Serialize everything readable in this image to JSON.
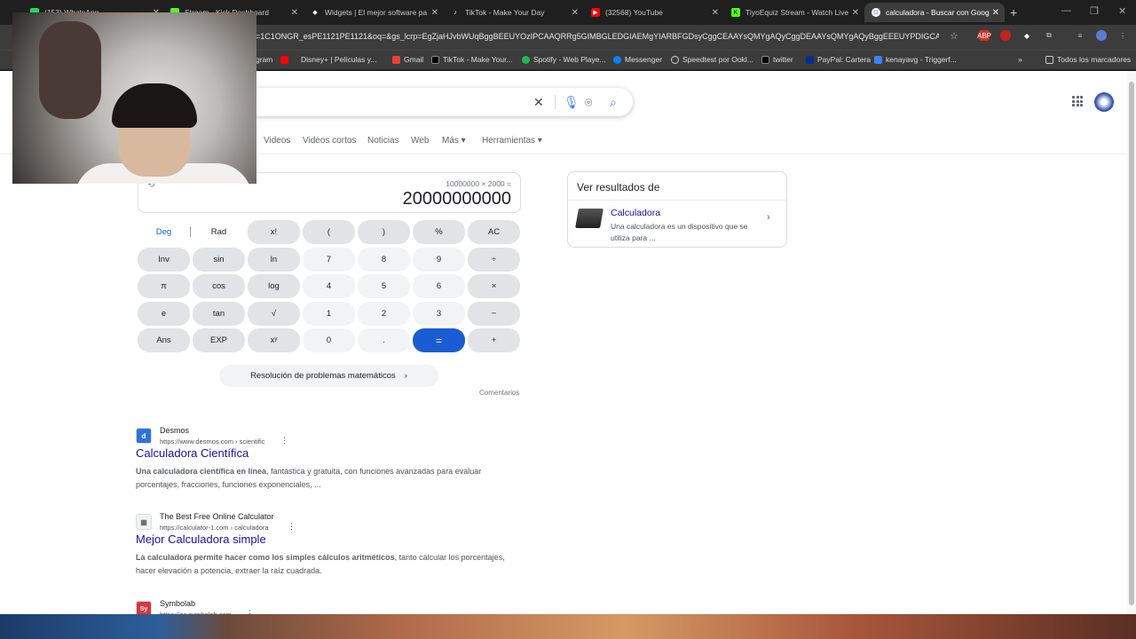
{
  "tabs": [
    {
      "label": "(153) WhatsApp",
      "color": "#25d366"
    },
    {
      "label": "Stream - Kick Dashboard",
      "color": "#53fc18"
    },
    {
      "label": "Widgets | El mejor software pa",
      "color": "#ffffff"
    },
    {
      "label": "TikTok - Make Your Day",
      "color": "#000000"
    },
    {
      "label": "(32568) YouTube",
      "color": "#ff0000"
    },
    {
      "label": "TiyoEquiz Stream - Watch Live",
      "color": "#53fc18"
    },
    {
      "label": "calculadora - Buscar con Goog",
      "color": "#4285f4"
    }
  ],
  "new_tab": "+",
  "url": "=1C1ONGR_esPE1121PE1121&oq=&gs_lcrp=EgZjaHJvbWUqBggBEEUYOzIPCAAQRRg5GIMBGLEDGIAEMgYIARBFGDsyCggCEAAYsQMYgAQyCggDEAAYsQMYgAQyBggEEEUYPDIGCAUQR...",
  "bookmarks": [
    {
      "label": "gram"
    },
    {
      "label": "Disney+ | Películas y..."
    },
    {
      "label": "Gmail"
    },
    {
      "label": "TikTok - Make Your..."
    },
    {
      "label": "Spotify - Web Playe..."
    },
    {
      "label": "Messenger"
    },
    {
      "label": "Speedtest por Ookl..."
    },
    {
      "label": "twitter"
    },
    {
      "label": "PayPal: Cartera"
    },
    {
      "label": "kenayavg - Triggerf..."
    }
  ],
  "all_bookmarks": "Todos los marcadores",
  "filters": [
    "Videos",
    "Videos cortos",
    "Noticias",
    "Web",
    "Más",
    "Herramientas"
  ],
  "calculator": {
    "expression": "10000000 × 2000 =",
    "result": "20000000000",
    "keys": [
      [
        "Deg",
        "Rad",
        "x!",
        "(",
        ")",
        "%",
        "AC"
      ],
      [
        "Inv",
        "sin",
        "ln",
        "7",
        "8",
        "9",
        "÷"
      ],
      [
        "π",
        "cos",
        "log",
        "4",
        "5",
        "6",
        "×"
      ],
      [
        "e",
        "tan",
        "√",
        "1",
        "2",
        "3",
        "−"
      ],
      [
        "Ans",
        "EXP",
        "xʸ",
        "0",
        ".",
        "=",
        "+"
      ]
    ],
    "math_solver": "Resolución de problemas matemáticos",
    "feedback": "Comentarios"
  },
  "side_panel": {
    "title": "Ver resultados de",
    "name": "Calculadora",
    "description": "Una calculadora es un dispositivo que se utiliza para ..."
  },
  "results": [
    {
      "site": "Desmos",
      "url": "https://www.desmos.com › scientific",
      "title": "Calculadora Científica",
      "snippet_bold": "Una calculadora científica en línea",
      "snippet_rest": ", fantástica y gratuita, con funciones avanzadas para evaluar porcentajes, fracciones, funciones exponenciales, ...",
      "favicon": "d"
    },
    {
      "site": "The Best Free Online Calculator",
      "url": "https://calculator-1.com › calculadora",
      "title": "Mejor Calculadora simple",
      "snippet_bold": "La calculadora permite hacer como los simples cálculos aritméticos",
      "snippet_rest": ", tanto calcular los porcentajes, hacer elevación a potencia, extraer la raíz cuadrada.",
      "favicon": "▦"
    },
    {
      "site": "Symbolab",
      "url": "https://es.symbolab.com",
      "title": "",
      "snippet_bold": "",
      "snippet_rest": "",
      "favicon": "Sy"
    }
  ]
}
